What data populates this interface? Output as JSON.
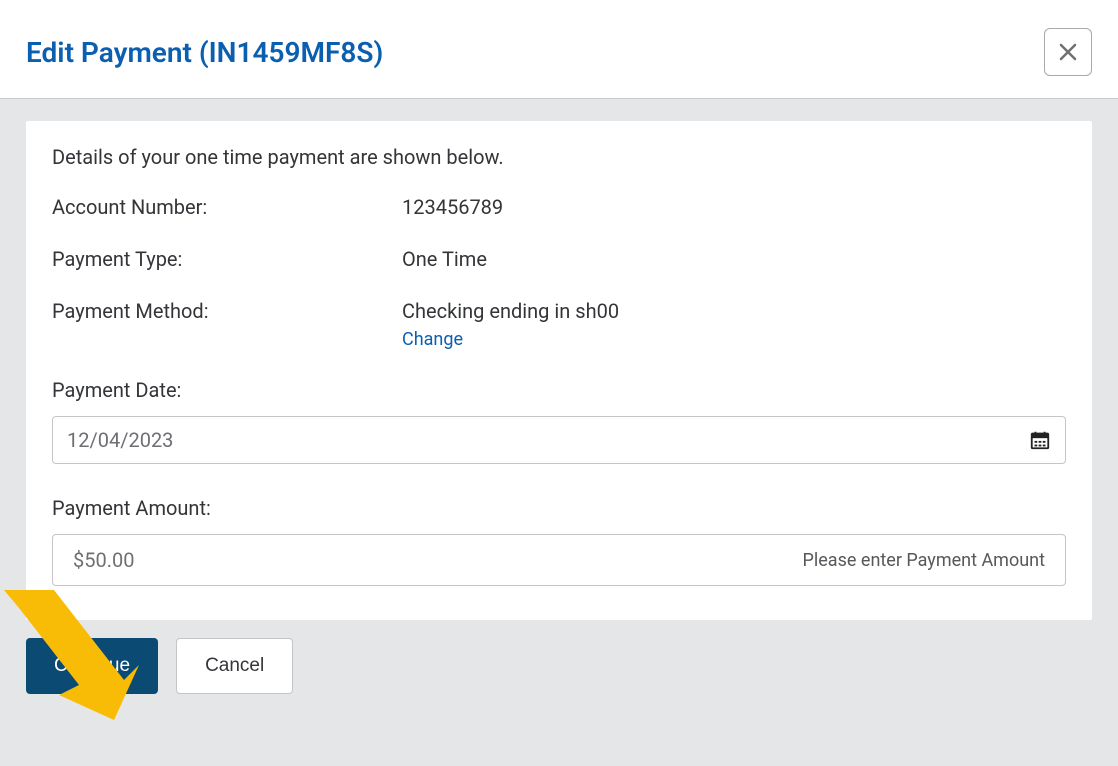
{
  "header": {
    "title": "Edit Payment (IN1459MF8S)"
  },
  "intro": "Details of your one time payment are shown below.",
  "details": {
    "account_label": "Account Number:",
    "account_value": "123456789",
    "type_label": "Payment Type:",
    "type_value": "One Time",
    "method_label": "Payment Method:",
    "method_value": "Checking ending in sh00",
    "change_link": "Change"
  },
  "date": {
    "label": "Payment Date:",
    "value": "12/04/2023"
  },
  "amount": {
    "label": "Payment Amount:",
    "value": "$50.00",
    "hint": "Please enter Payment Amount"
  },
  "buttons": {
    "continue": "Continue",
    "cancel": "Cancel"
  }
}
